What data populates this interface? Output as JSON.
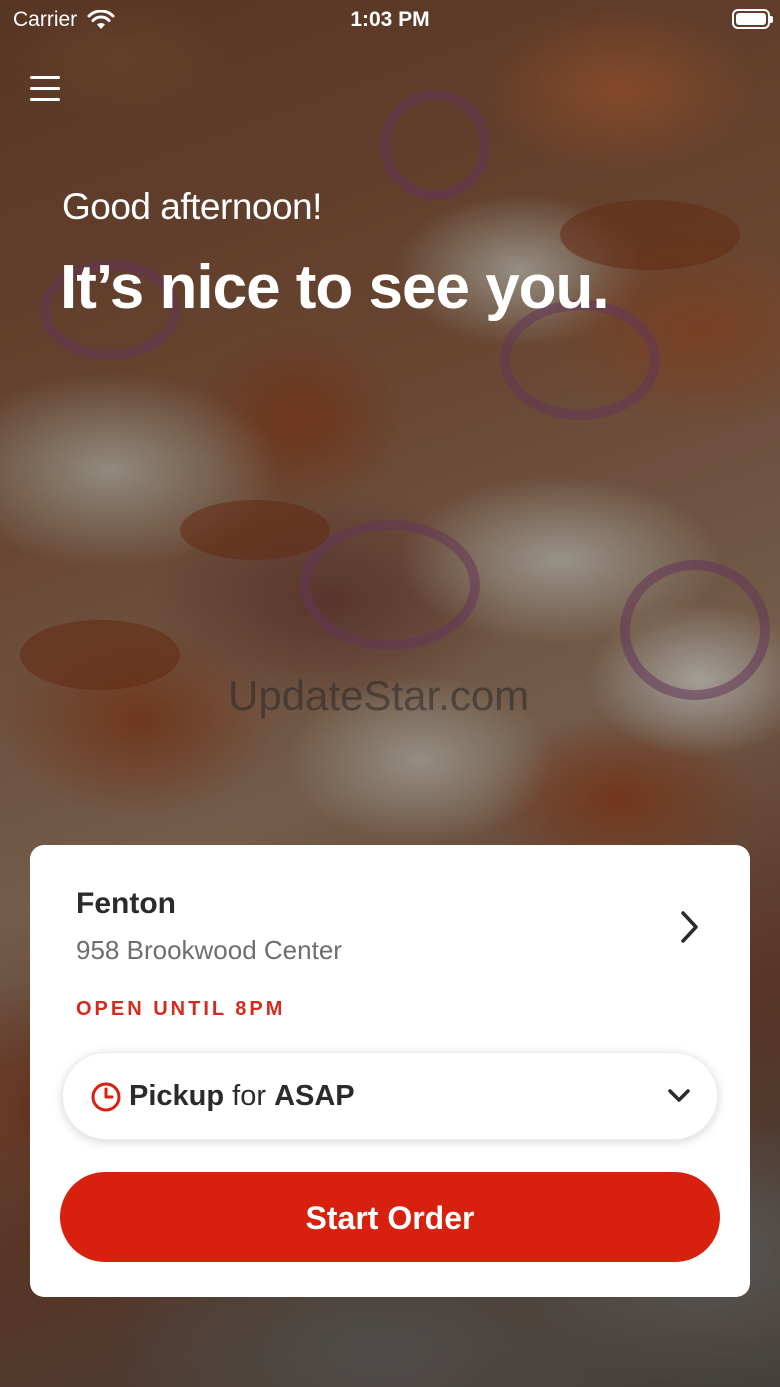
{
  "status_bar": {
    "carrier": "Carrier",
    "time": "1:03 PM"
  },
  "hero": {
    "greeting": "Good afternoon!",
    "headline": "It’s nice to see you.",
    "watermark": "UpdateStar.com"
  },
  "store": {
    "name": "Fenton",
    "address": "958 Brookwood Center",
    "hours": "OPEN UNTIL 8PM"
  },
  "order_mode": {
    "mode": "Pickup",
    "connector": "for",
    "time": "ASAP"
  },
  "actions": {
    "start_order_label": "Start Order"
  },
  "colors": {
    "accent_red": "#d8200e",
    "hours_red": "#d52b1e",
    "card_bg": "#ffffff"
  },
  "icons": {
    "menu": "hamburger-menu-icon",
    "store_chevron": "chevron-right-icon",
    "clock": "clock-icon",
    "dropdown": "chevron-down-icon",
    "wifi": "wifi-icon",
    "battery": "battery-icon"
  }
}
